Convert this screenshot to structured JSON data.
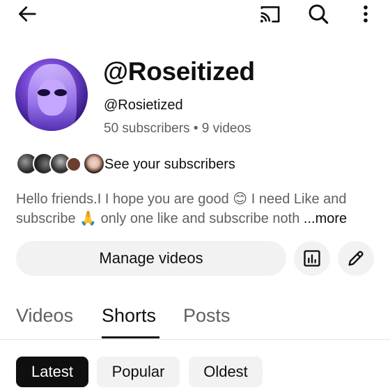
{
  "topbar": {
    "back_icon": "arrow-left-icon",
    "cast_icon": "cast-icon",
    "search_icon": "search-icon",
    "more_icon": "more-vertical-icon"
  },
  "channel": {
    "name": "@Roseitized",
    "handle": "@Rosietized",
    "subscribers": "50 subscribers",
    "separator": "•",
    "videos": "9 videos",
    "see_subscribers": "See your subscribers",
    "description_line1": "Hello friends.I I hope you are good 😊 I need Like and",
    "description_line2": "subscribe 🙏 only one like and subscribe noth",
    "more_label": "...more"
  },
  "actions": {
    "manage_videos": "Manage videos",
    "analytics_icon": "analytics-icon",
    "edit_icon": "pencil-icon"
  },
  "tabs": [
    {
      "label": "Videos",
      "selected": false
    },
    {
      "label": "Shorts",
      "selected": true
    },
    {
      "label": "Posts",
      "selected": false
    }
  ],
  "chips": [
    {
      "label": "Latest",
      "selected": true
    },
    {
      "label": "Popular",
      "selected": false
    },
    {
      "label": "Oldest",
      "selected": false
    }
  ],
  "colors": {
    "text_primary": "#0f0f0f",
    "text_secondary": "#606060",
    "chip_bg": "#f2f2f2",
    "chip_selected_bg": "#0f0f0f"
  }
}
